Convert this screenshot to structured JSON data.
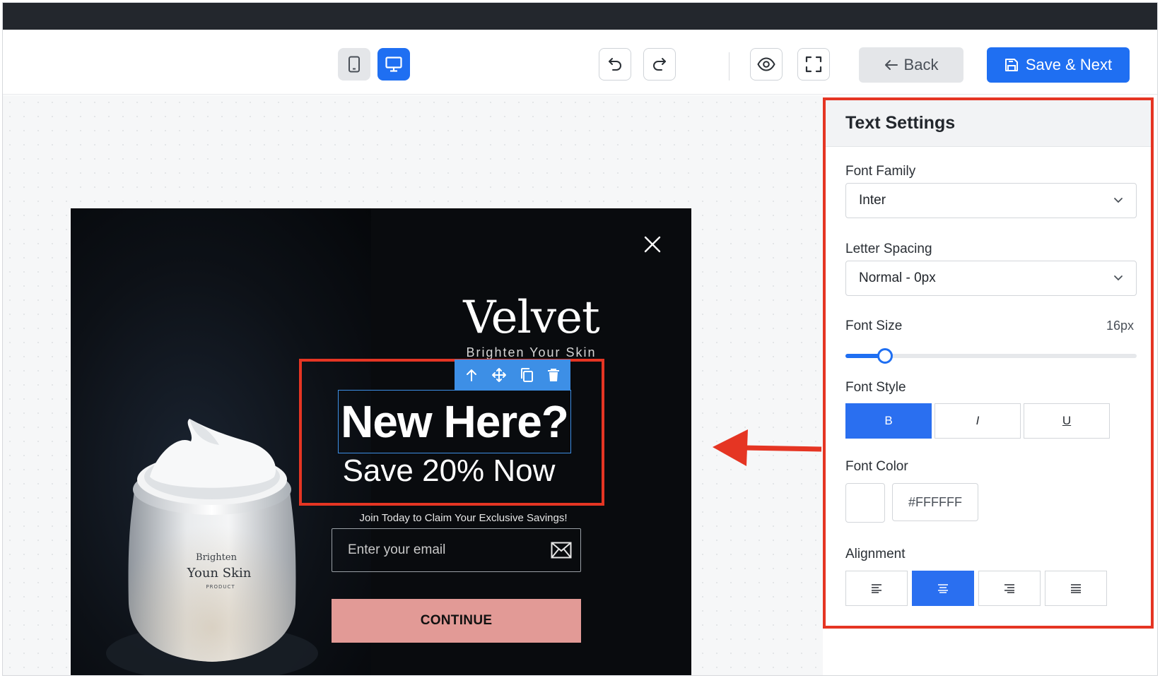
{
  "toolbar": {
    "back_label": "Back",
    "save_label": "Save & Next",
    "accent_color": "#1f6ff2"
  },
  "popup": {
    "brand": "Velvet",
    "tagline": "Brighten Your Skin",
    "headline": "New Here?",
    "subheadline": "Save 20% Now",
    "join_text": "Join Today to Claim Your Exclusive Savings!",
    "email_placeholder": "Enter your email",
    "continue_label": "CONTINUE",
    "jar_label_line1": "Brighten",
    "jar_label_line2": "Youn Skin",
    "jar_label_line3": "PRODUCT",
    "button_color": "#e29a96"
  },
  "panel": {
    "title": "Text Settings",
    "font_family_label": "Font Family",
    "font_family_value": "Inter",
    "letter_spacing_label": "Letter Spacing",
    "letter_spacing_value": "Normal - 0px",
    "font_size_label": "Font Size",
    "font_size_value": "16px",
    "font_size_slider_fraction": 0.135,
    "font_style_label": "Font Style",
    "font_style_bold": "B",
    "font_style_italic": "I",
    "font_style_underline": "U",
    "font_color_label": "Font Color",
    "font_color_value": "#FFFFFF",
    "alignment_label": "Alignment",
    "alignment_selected": "center"
  },
  "highlight_color": "#e53523"
}
